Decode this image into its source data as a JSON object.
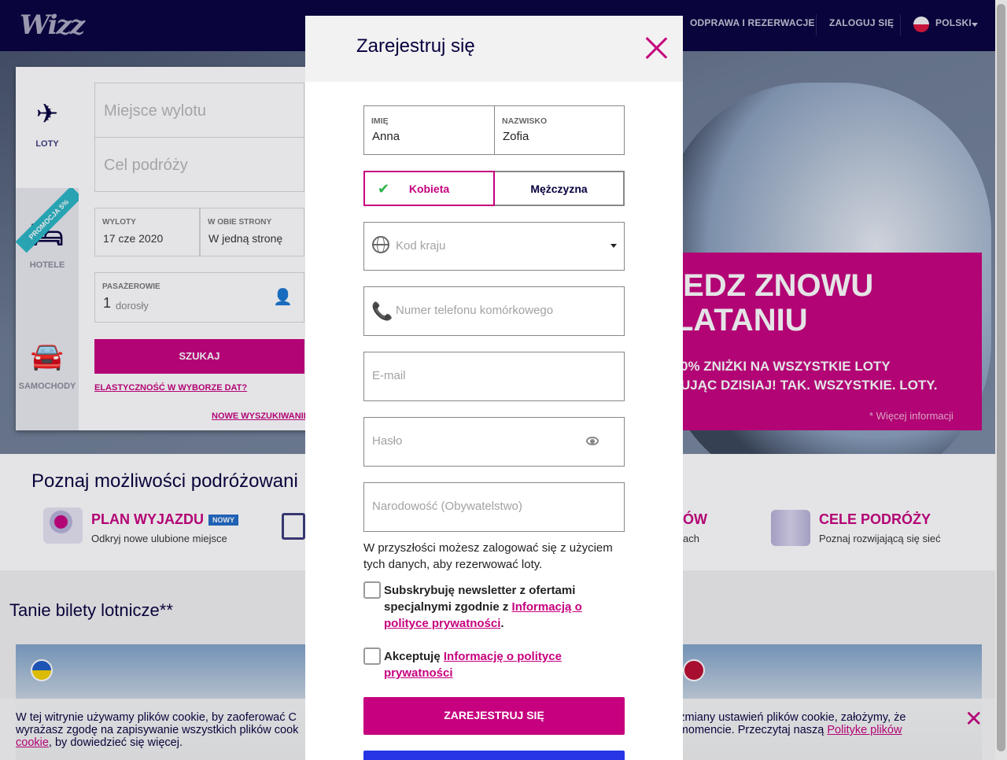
{
  "header": {
    "logo": "Wizz",
    "nav": [
      "ODPRAWA I REZERWACJE",
      "ZALOGUJ SIĘ",
      "POLSKI"
    ]
  },
  "search": {
    "tabs": [
      "LOTY",
      "HOTELE",
      "SAMOCHODY"
    ],
    "promo_ribbon": "PROMOCJA 5%",
    "departure_ph": "Miejsce wylotu",
    "destination_ph": "Cel podróży",
    "dates_label": "WYLOTY",
    "dates_value": "17 cze 2020",
    "trip_label": "W OBIE STRONY",
    "trip_value": "W jedną stronę",
    "pax_label": "PASAŻEROWIE",
    "pax_count": "1",
    "pax_type": "dorosły",
    "search_btn": "SZUKAJ",
    "flex_link": "ELASTYCZNOŚĆ W WYBORZE DAT?",
    "new_search": "NOWE WYSZUKIWANIE"
  },
  "promo": {
    "line1": "IEDZ ZNOWU",
    "line2": "LATANIU",
    "sub1": "0% ZNIŻKI NA WSZYSTKIE LOTY",
    "sub2": "UJĄC DZISIAJ! TAK. WSZYSTKIE. LOTY.",
    "more": "* Więcej informacji"
  },
  "features": {
    "title": "Poznaj możliwości podróżowani",
    "items": [
      {
        "title": "PLAN WYJAZDU",
        "badge": "NOWY",
        "desc": "Odkryj nowe ulubione miejsce"
      },
      {
        "title": "ÓW",
        "desc": "ach"
      },
      {
        "title": "CELE PODRÓŻY",
        "desc": "Poznaj rozwijającą się sieć"
      }
    ]
  },
  "cheap": {
    "title": "Tanie bilety lotnicze**"
  },
  "cookie": {
    "text_a": "W tej witrynie używamy plików cookie, by zaoferować C",
    "text_b": "r bez zmiany ustawień plików cookie, założymy, że",
    "text_c": "wyrażasz zgodę na zapisywanie wszystkich plików cook",
    "text_d": "ym momencie. Przeczytaj naszą",
    "link1": "Polityke plików",
    "link2": "cookie",
    "tail": ", by dowiedzieć się więcej."
  },
  "modal": {
    "title": "Zarejestruj się",
    "first_name_label": "IMIĘ",
    "first_name": "Anna",
    "last_name_label": "NAZWISKO",
    "last_name": "Zofia",
    "gender_female": "Kobieta",
    "gender_male": "Mężczyzna",
    "country_code_ph": "Kod kraju",
    "phone_ph": "Numer telefonu komórkowego",
    "email_ph": "E-mail",
    "password_ph": "Hasło",
    "nationality_ph": "Narodowość (Obywatelstwo)",
    "info": "W przyszłości możesz zalogować się z użyciem tych danych, aby rezerwować loty.",
    "newsletter_text": "Subskrybuję newsletter z ofertami specjalnymi zgodnie z",
    "newsletter_link": "Informacją o polityce prywatności",
    "accept_text": "Akceptuję",
    "accept_link": "Informację o polityce prywatności",
    "register_btn": "ZAREJESTRUJ SIĘ"
  },
  "colors": {
    "brand": "#c6007e",
    "navy": "#06003d"
  }
}
